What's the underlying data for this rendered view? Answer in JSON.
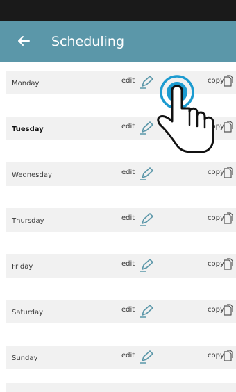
{
  "app_bar": {
    "title": "Scheduling",
    "back_icon": "arrow-left-icon",
    "background": "#5b97a9",
    "text_color": "#ffffff"
  },
  "status_bar": {
    "background": "#1a1a1a"
  },
  "rows": [
    {
      "day": "Monday",
      "edit": "edit",
      "copy": "copy"
    },
    {
      "day": "Tuesday",
      "edit": "edit",
      "copy": "copy"
    },
    {
      "day": "Wednesday",
      "edit": "edit",
      "copy": "copy"
    },
    {
      "day": "Thursday",
      "edit": "edit",
      "copy": "copy"
    },
    {
      "day": "Friday",
      "edit": "edit",
      "copy": "copy"
    },
    {
      "day": "Saturday",
      "edit": "edit",
      "copy": "copy"
    },
    {
      "day": "Sunday",
      "edit": "edit",
      "copy": "copy"
    }
  ],
  "icons": {
    "edit": "pencil-icon",
    "copy": "copy-icon",
    "gesture": "tap-gesture-icon"
  },
  "colors": {
    "row_background": "#f1f1f1",
    "pencil": "#5b97a9",
    "tap_ring": "#1c9bd0"
  }
}
